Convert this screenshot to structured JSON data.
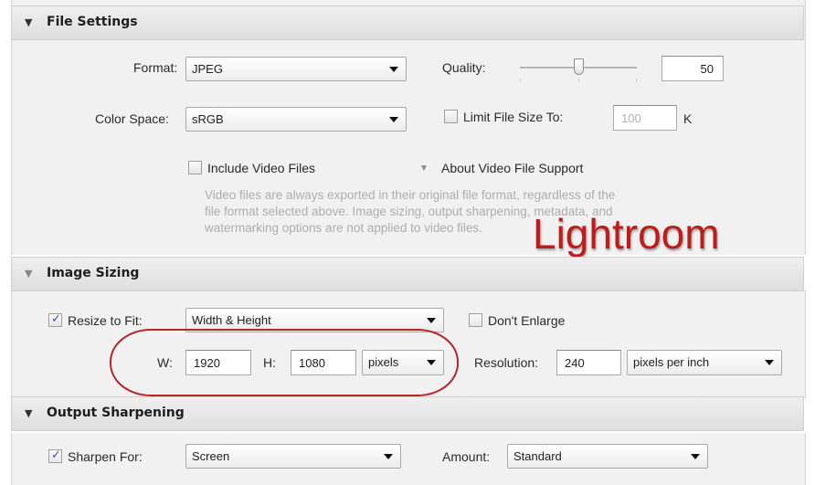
{
  "file_settings": {
    "title": "File Settings",
    "format_label": "Format:",
    "format_value": "JPEG",
    "quality_label": "Quality:",
    "quality_value": "50",
    "quality_level_percent": 50,
    "color_space_label": "Color Space:",
    "color_space_value": "sRGB",
    "limit_file_size_label": "Limit File Size To:",
    "limit_file_size_value": "100",
    "limit_file_size_unit": "K",
    "include_video_label": "Include Video Files",
    "about_video_label": "About Video File Support",
    "video_note_line1": "Video files are always exported in their original file format, regardless of the",
    "video_note_line2": "file format selected above. Image sizing, output sharpening, metadata, and",
    "video_note_line3": "watermarking options are not applied to video files."
  },
  "watermark_text": "Lightroom",
  "image_sizing": {
    "title": "Image Sizing",
    "resize_to_fit_label": "Resize to Fit:",
    "resize_mode_value": "Width & Height",
    "dont_enlarge_label": "Don't Enlarge",
    "width_label": "W:",
    "width_value": "1920",
    "height_label": "H:",
    "height_value": "1080",
    "units_value": "pixels",
    "resolution_label": "Resolution:",
    "resolution_value": "240",
    "resolution_units_value": "pixels per inch"
  },
  "output_sharpening": {
    "title": "Output Sharpening",
    "sharpen_for_label": "Sharpen For:",
    "sharpen_for_value": "Screen",
    "amount_label": "Amount:",
    "amount_value": "Standard"
  },
  "colors": {
    "annotation_red": "#b5232b",
    "watermark_red": "#c01b1b",
    "check_blue": "#3355aa"
  },
  "icons": {
    "section_toggle": "triangle-down-icon",
    "dropdown": "chevron-down-icon",
    "checkbox_checked": "check-icon"
  }
}
